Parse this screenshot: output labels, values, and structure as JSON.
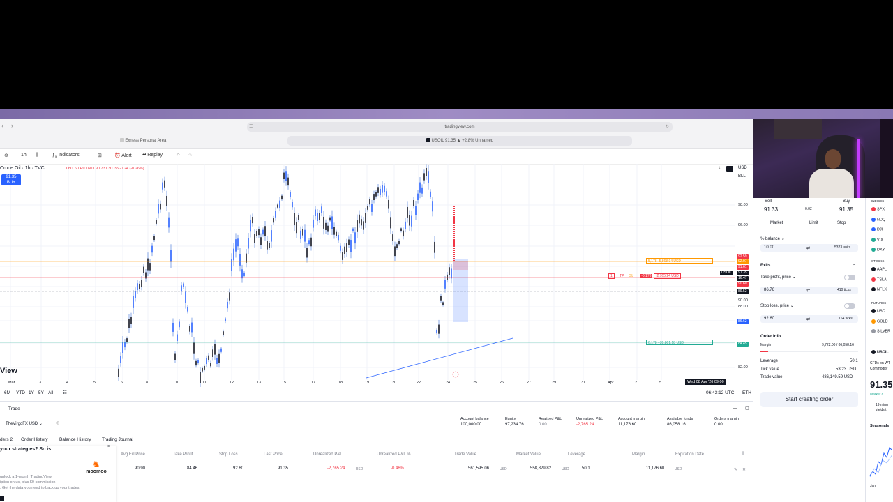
{
  "browser": {
    "url": "tradingview.com",
    "tabs": [
      {
        "label": "Exness Personal Area"
      },
      {
        "label": "USOIL 91.35 ▲ +2.8% Unnamed"
      }
    ]
  },
  "toolbar": {
    "interval": "1h",
    "indicators": "Indicators",
    "alert": "Alert",
    "replay": "Replay"
  },
  "chart": {
    "symbol": "Crude Oil · 1h · TVC",
    "ohlc": "O91.60 H91.60 L90.73 C91.35 -0.24 (-0.26%)",
    "buy_badge_price": "91.35",
    "buy_badge_label": "BUY",
    "currency": "USD",
    "blank_label": "BLL",
    "watermark": "View",
    "y_ticks": [
      "98.00",
      "96.00",
      "90.00",
      "88.00",
      "86.00",
      "84.00",
      "82.00"
    ],
    "x_ticks": [
      "Mar",
      "3",
      "4",
      "5",
      "6",
      "8",
      "10",
      "11",
      "12",
      "13",
      "15",
      "17",
      "18",
      "19",
      "20",
      "22",
      "24",
      "25",
      "26",
      "27",
      "29",
      "31",
      "Apr",
      "2",
      "5"
    ],
    "crosshair_date": "Wed 08 Apr '26  09:00",
    "price_labels": [
      {
        "text": "92.59",
        "color": "#f23645"
      },
      {
        "text": "92.07",
        "color": "#ff9800"
      },
      {
        "text": "91.61",
        "color": "#f23645"
      },
      {
        "text": "91.35",
        "color": "#131722"
      },
      {
        "text": "16:47",
        "color": "#131722"
      },
      {
        "text": "90.60",
        "color": "#f23645"
      },
      {
        "text": "89.52",
        "color": "#131722"
      },
      {
        "text": "86.62",
        "color": "#2962ff"
      },
      {
        "text": "84.45",
        "color": "#22ab94"
      }
    ],
    "usoil_tag": "USOIL",
    "orders": {
      "tp_line": "5,178  -5,868.94 USD",
      "position_line": "-6,178",
      "position_pnl": "-2,765.24 USD",
      "sl_line": "6,178  +39,801.18 USD",
      "tp_tag": "TP",
      "sl_tag": "SL"
    },
    "ranges": [
      "6M",
      "YTD",
      "1Y",
      "5Y",
      "All"
    ],
    "clock": "06:43:12 UTC",
    "session": "ETH"
  },
  "panel": {
    "title": "Trade",
    "account_name": "TheVirgoFX USD",
    "stats": [
      {
        "label": "Account balance",
        "value": "100,000.00"
      },
      {
        "label": "Equity",
        "value": "97,234.76"
      },
      {
        "label": "Realized P&L",
        "value": "0.00"
      },
      {
        "label": "Unrealized P&L",
        "value": "-2,765.24"
      },
      {
        "label": "Account margin",
        "value": "11,176.60"
      },
      {
        "label": "Available funds",
        "value": "86,058.16"
      },
      {
        "label": "Orders margin",
        "value": "0.00"
      }
    ],
    "tabs": [
      "ders 2",
      "Order History",
      "Balance History",
      "Trading Journal"
    ],
    "columns": [
      "Avg Fill Price",
      "Take Profit",
      "Stop Loss",
      "Last Price",
      "Unrealized P&L",
      "Unrealized P&L %",
      "Trade Value",
      "Market Value",
      "Leverage",
      "Margin",
      "Expiration Date"
    ],
    "row": [
      "90.90",
      "84.46",
      "92.60",
      "91.35",
      "-2,765.24",
      "-0.46%",
      "561,595.06",
      "558,829.82",
      "50:1",
      "11,176.60",
      ""
    ],
    "row_unit": "USD",
    "promo": {
      "headline": "your strategies? So is",
      "line1": "unlock a 1-month TradingView",
      "line2": "iption on us, plus $0 commission",
      "line3": ". Get the data you need to back up your trades.",
      "brand": "moomoo"
    }
  },
  "orderpanel": {
    "sell_label": "Sell",
    "sell_price": "91.33",
    "spread": "0.02",
    "buy_label": "Buy",
    "buy_price": "91.35",
    "tabs": [
      "Market",
      "Limit",
      "Stop"
    ],
    "balance_label": "% balance",
    "qty_value": "10.00",
    "qty_units": "5323 units",
    "exits_label": "Exits",
    "tp_label": "Take profit, price",
    "tp_value": "86.76",
    "tp_ticks": "410 ticks",
    "sl_label": "Stop loss, price",
    "sl_value": "92.60",
    "sl_ticks": "164 ticks",
    "order_info": "Order info",
    "margin_label": "Margin",
    "margin_value": "9,722.00 / 86,058.16",
    "leverage_label": "Leverage",
    "leverage_value": "50:1",
    "tick_label": "Tick value",
    "tick_value": "53.23 USD",
    "trade_value_label": "Trade value",
    "trade_value": "486,149.59 USD",
    "cta": "Start creating order"
  },
  "watchlist": {
    "section1": "INDICES",
    "items1": [
      {
        "sym": "SPX",
        "color": "#f23645"
      },
      {
        "sym": "NDQ",
        "color": "#2962ff"
      },
      {
        "sym": "DJI",
        "color": "#2962ff"
      },
      {
        "sym": "VIX",
        "color": "#22ab94"
      },
      {
        "sym": "DXY",
        "color": "#22ab94"
      }
    ],
    "section2": "STOCKS",
    "items2": [
      {
        "sym": "AAPL",
        "color": "#131722"
      },
      {
        "sym": "TSLA",
        "color": "#f23645"
      },
      {
        "sym": "NFLX",
        "color": "#131722"
      }
    ],
    "section3": "FUTURES",
    "items3": [
      {
        "sym": "USO",
        "color": "#131722"
      },
      {
        "sym": "GOLD",
        "color": "#ff9800"
      },
      {
        "sym": "SILVER",
        "color": "#9598a1"
      }
    ],
    "detail_sym": "USOIL",
    "detail_desc": "CFDs on WT",
    "detail_type": "Commodity",
    "detail_price": "91.35",
    "detail_market": "Market c",
    "detail_news1": "19 minu",
    "detail_news2": "yields t",
    "seasonals": "Seasonals",
    "jan": "Jan"
  }
}
